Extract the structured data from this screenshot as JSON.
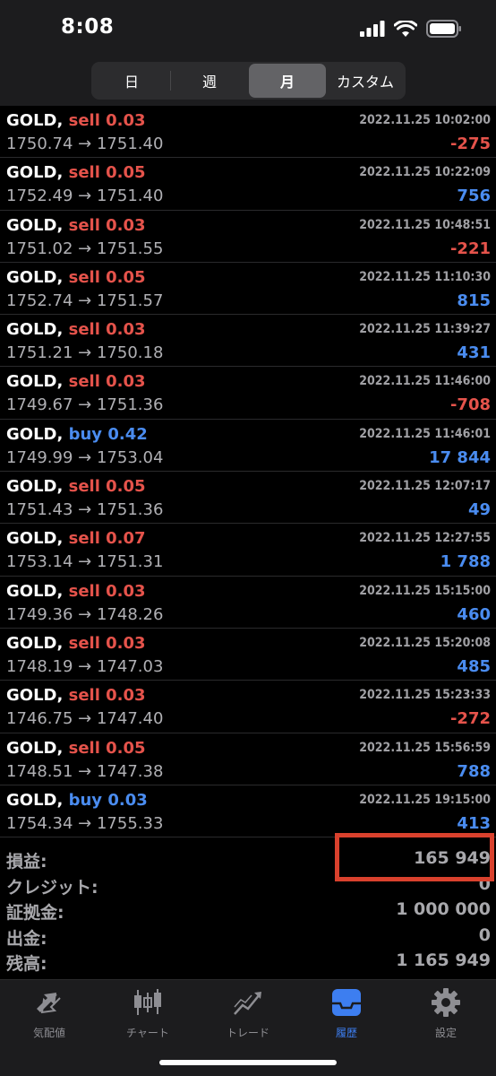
{
  "status": {
    "time": "8:08"
  },
  "segments": [
    {
      "label": "日",
      "active": false
    },
    {
      "label": "週",
      "active": false
    },
    {
      "label": "月",
      "active": true
    },
    {
      "label": "カスタム",
      "active": false
    }
  ],
  "trades": [
    {
      "symbol": "GOLD,",
      "side": "sell",
      "volume": "0.03",
      "datetime": "2022.11.25 10:02:00",
      "prices": "1750.74 → 1751.40",
      "profit": "-275",
      "sign": "neg"
    },
    {
      "symbol": "GOLD,",
      "side": "sell",
      "volume": "0.05",
      "datetime": "2022.11.25 10:22:09",
      "prices": "1752.49 → 1751.40",
      "profit": "756",
      "sign": "pos"
    },
    {
      "symbol": "GOLD,",
      "side": "sell",
      "volume": "0.03",
      "datetime": "2022.11.25 10:48:51",
      "prices": "1751.02 → 1751.55",
      "profit": "-221",
      "sign": "neg"
    },
    {
      "symbol": "GOLD,",
      "side": "sell",
      "volume": "0.05",
      "datetime": "2022.11.25 11:10:30",
      "prices": "1752.74 → 1751.57",
      "profit": "815",
      "sign": "pos"
    },
    {
      "symbol": "GOLD,",
      "side": "sell",
      "volume": "0.03",
      "datetime": "2022.11.25 11:39:27",
      "prices": "1751.21 → 1750.18",
      "profit": "431",
      "sign": "pos"
    },
    {
      "symbol": "GOLD,",
      "side": "sell",
      "volume": "0.03",
      "datetime": "2022.11.25 11:46:00",
      "prices": "1749.67 → 1751.36",
      "profit": "-708",
      "sign": "neg"
    },
    {
      "symbol": "GOLD,",
      "side": "buy",
      "volume": "0.42",
      "datetime": "2022.11.25 11:46:01",
      "prices": "1749.99 → 1753.04",
      "profit": "17 844",
      "sign": "pos"
    },
    {
      "symbol": "GOLD,",
      "side": "sell",
      "volume": "0.05",
      "datetime": "2022.11.25 12:07:17",
      "prices": "1751.43 → 1751.36",
      "profit": "49",
      "sign": "pos"
    },
    {
      "symbol": "GOLD,",
      "side": "sell",
      "volume": "0.07",
      "datetime": "2022.11.25 12:27:55",
      "prices": "1753.14 → 1751.31",
      "profit": "1 788",
      "sign": "pos"
    },
    {
      "symbol": "GOLD,",
      "side": "sell",
      "volume": "0.03",
      "datetime": "2022.11.25 15:15:00",
      "prices": "1749.36 → 1748.26",
      "profit": "460",
      "sign": "pos"
    },
    {
      "symbol": "GOLD,",
      "side": "sell",
      "volume": "0.03",
      "datetime": "2022.11.25 15:20:08",
      "prices": "1748.19 → 1747.03",
      "profit": "485",
      "sign": "pos"
    },
    {
      "symbol": "GOLD,",
      "side": "sell",
      "volume": "0.03",
      "datetime": "2022.11.25 15:23:33",
      "prices": "1746.75 → 1747.40",
      "profit": "-272",
      "sign": "neg"
    },
    {
      "symbol": "GOLD,",
      "side": "sell",
      "volume": "0.05",
      "datetime": "2022.11.25 15:56:59",
      "prices": "1748.51 → 1747.38",
      "profit": "788",
      "sign": "pos"
    },
    {
      "symbol": "GOLD,",
      "side": "buy",
      "volume": "0.03",
      "datetime": "2022.11.25 19:15:00",
      "prices": "1754.34 → 1755.33",
      "profit": "413",
      "sign": "pos"
    }
  ],
  "summary": [
    {
      "label": "損益:",
      "value": "165 949"
    },
    {
      "label": "クレジット:",
      "value": "0"
    },
    {
      "label": "証拠金:",
      "value": "1 000 000"
    },
    {
      "label": "出金:",
      "value": "0"
    },
    {
      "label": "残高:",
      "value": "1 165 949"
    }
  ],
  "tabs": [
    {
      "label": "気配値",
      "icon": "quotes-arrows-icon",
      "active": false
    },
    {
      "label": "チャート",
      "icon": "candlestick-chart-icon",
      "active": false
    },
    {
      "label": "トレード",
      "icon": "trade-chart-icon",
      "active": false
    },
    {
      "label": "履歴",
      "icon": "history-tray-icon",
      "active": true
    },
    {
      "label": "設定",
      "icon": "gear-icon",
      "active": false
    }
  ],
  "colors": {
    "sell": "#e5534b",
    "buy": "#4a8cf0",
    "highlight": "#d9412d",
    "active_tab": "#3d7ef0"
  }
}
